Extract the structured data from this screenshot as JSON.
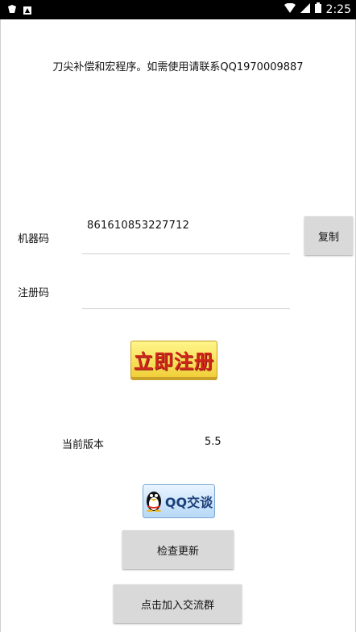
{
  "status_bar": {
    "time": "2:25"
  },
  "notice": "刀尖补偿和宏程序。如需使用请联系QQ1970009887",
  "machine_code": {
    "label": "机器码",
    "value": "861610853227712"
  },
  "copy_button": "复制",
  "register_code": {
    "label": "注册码",
    "value": ""
  },
  "register_button": "立即注册",
  "version": {
    "label": "当前版本",
    "value": "5.5"
  },
  "qq_button": "QQ交谈",
  "update_button": "检查更新",
  "group_button": "点击加入交流群"
}
